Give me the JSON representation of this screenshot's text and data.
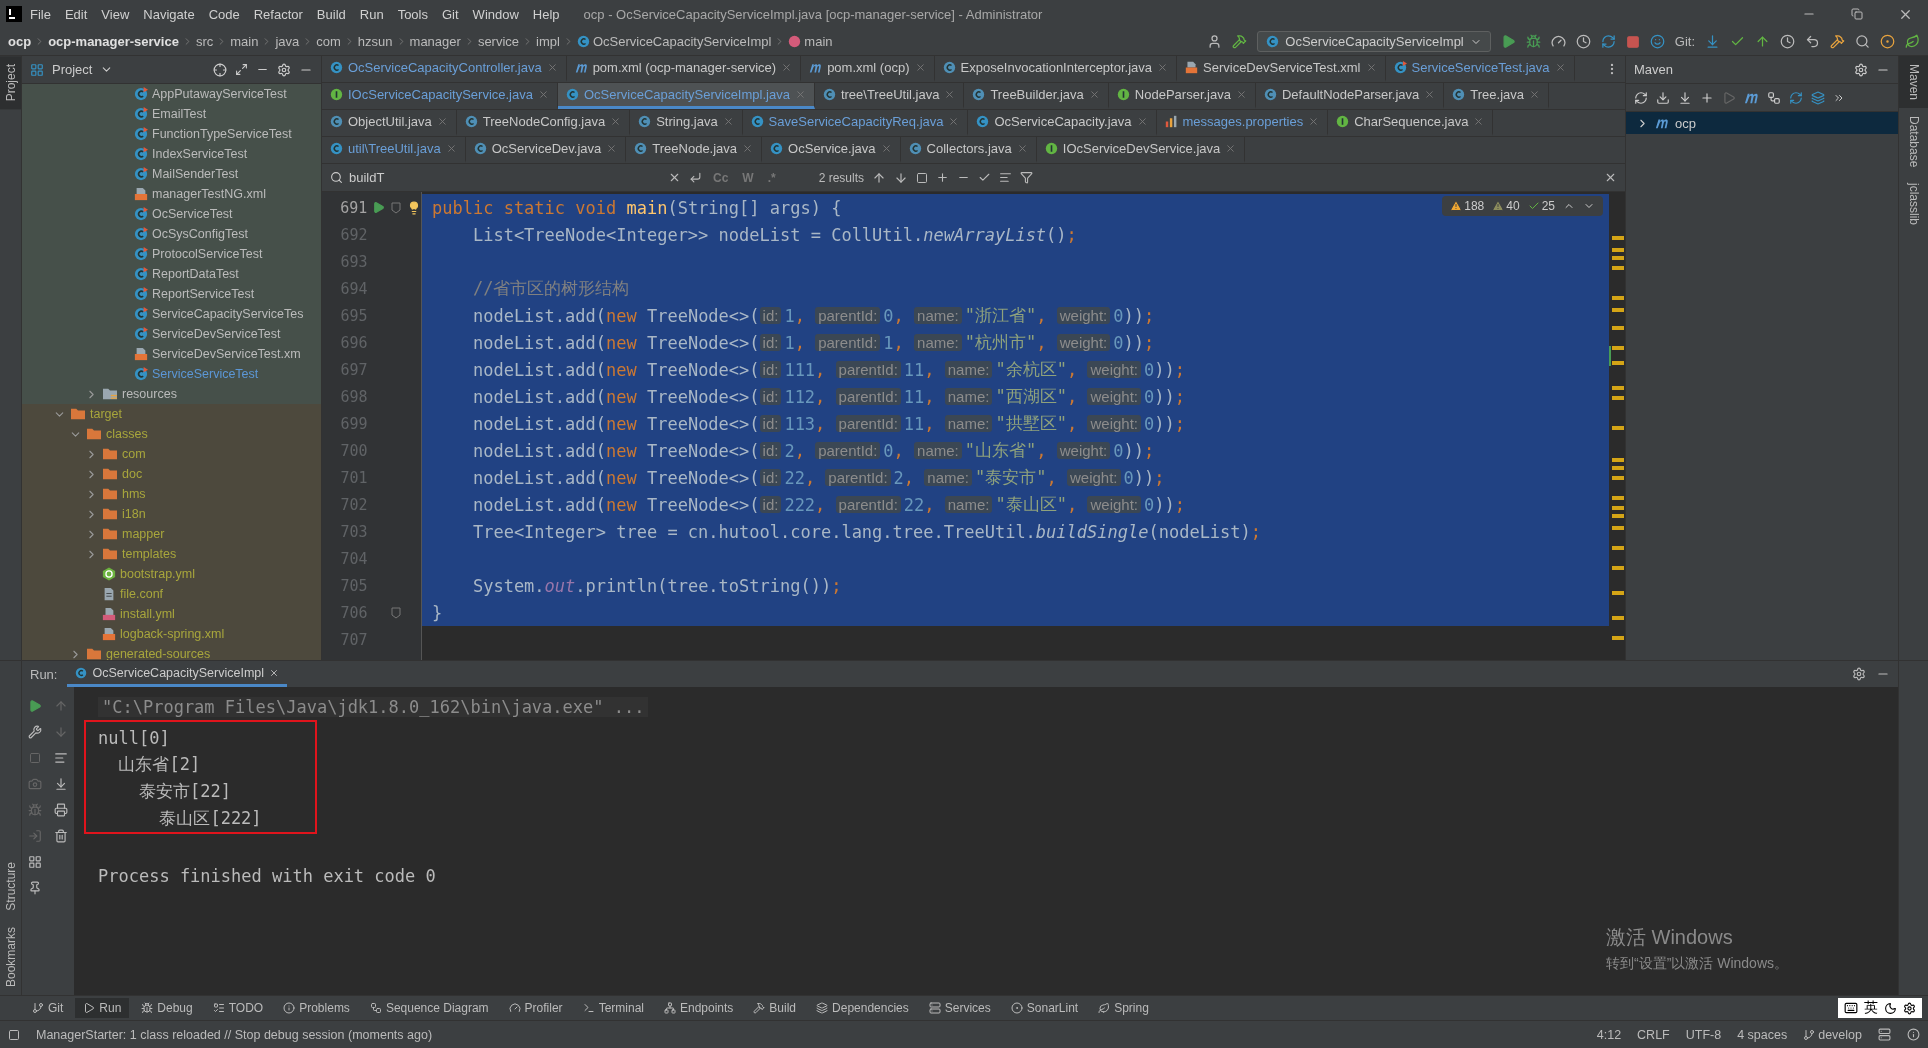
{
  "window": {
    "title": "ocp - OcServiceCapacityServiceImpl.java [ocp-manager-service] - Administrator"
  },
  "menu": [
    "File",
    "Edit",
    "View",
    "Navigate",
    "Code",
    "Refactor",
    "Build",
    "Run",
    "Tools",
    "Git",
    "Window",
    "Help"
  ],
  "breadcrumbs": [
    {
      "label": "ocp",
      "kind": "project"
    },
    {
      "label": "ocp-manager-service",
      "kind": "module"
    },
    {
      "label": "src",
      "kind": "folder"
    },
    {
      "label": "main",
      "kind": "folder"
    },
    {
      "label": "java",
      "kind": "folder"
    },
    {
      "label": "com",
      "kind": "folder"
    },
    {
      "label": "hzsun",
      "kind": "folder"
    },
    {
      "label": "manager",
      "kind": "folder"
    },
    {
      "label": "service",
      "kind": "folder"
    },
    {
      "label": "impl",
      "kind": "folder"
    },
    {
      "label": "OcServiceCapacityServiceImpl",
      "kind": "class"
    },
    {
      "label": "main",
      "kind": "method"
    }
  ],
  "run_config": "OcServiceCapacityServiceImpl",
  "git_label": "Git:",
  "left_strip": {
    "top": [
      {
        "label": "Project",
        "selected": true
      }
    ],
    "bottom": [
      {
        "label": "Structure",
        "selected": false
      },
      {
        "label": "Bookmarks",
        "selected": false
      }
    ]
  },
  "project": {
    "title": "Project",
    "tree": [
      {
        "test_sources": true,
        "children": [
          {
            "children": [
              {
                "children": [
                  {
                    "children": [
                      {
                        "label": "AppPutawayServiceTest",
                        "kind": "test-class"
                      },
                      {
                        "label": "EmailTest",
                        "kind": "test-class"
                      },
                      {
                        "label": "FunctionTypeServiceTest",
                        "kind": "test-class"
                      },
                      {
                        "label": "IndexServiceTest",
                        "kind": "test-class"
                      },
                      {
                        "label": "MailSenderTest",
                        "kind": "test-class"
                      },
                      {
                        "label": "managerTestNG.xml",
                        "kind": "xml"
                      },
                      {
                        "label": "OcServiceTest",
                        "kind": "test-class"
                      },
                      {
                        "label": "OcSysConfigTest",
                        "kind": "test-class"
                      },
                      {
                        "label": "ProtocolServiceTest",
                        "kind": "test-class"
                      },
                      {
                        "label": "ReportDataTest",
                        "kind": "test-class"
                      },
                      {
                        "label": "ReportServiceTest",
                        "kind": "test-class"
                      },
                      {
                        "label": "ServiceCapacityServiceTes",
                        "kind": "test-class"
                      },
                      {
                        "label": "ServiceDevServiceTest",
                        "kind": "test-class"
                      },
                      {
                        "label": "ServiceDevServiceTest.xm",
                        "kind": "xml"
                      },
                      {
                        "label": "ServiceServiceTest",
                        "kind": "test-class",
                        "color": "#5c97d6"
                      }
                    ]
                  }
                ]
              },
              {
                "label": "resources",
                "kind": "resources-folder",
                "expanded": false
              }
            ]
          }
        ]
      },
      {
        "label": "target",
        "kind": "folder",
        "expanded": true,
        "excluded": true,
        "children": [
          {
            "label": "classes",
            "kind": "folder",
            "expanded": true,
            "children": [
              {
                "label": "com",
                "kind": "folder",
                "expanded": false
              },
              {
                "label": "doc",
                "kind": "folder",
                "expanded": false
              },
              {
                "label": "hms",
                "kind": "folder",
                "expanded": false
              },
              {
                "label": "i18n",
                "kind": "folder",
                "expanded": false
              },
              {
                "label": "mapper",
                "kind": "folder",
                "expanded": false
              },
              {
                "label": "templates",
                "kind": "folder",
                "expanded": false
              },
              {
                "label": "bootstrap.yml",
                "kind": "spring"
              },
              {
                "label": "file.conf",
                "kind": "file"
              },
              {
                "label": "install.yml",
                "kind": "yml"
              },
              {
                "label": "logback-spring.xml",
                "kind": "xml"
              }
            ]
          },
          {
            "label": "generated-sources",
            "kind": "folder",
            "expanded": false
          }
        ]
      }
    ]
  },
  "editor": {
    "tab_rows": [
      {
        "tabs": [
          {
            "label": "OcServiceCapacityController.java",
            "kind": "class",
            "color": "#6a9fd8",
            "selected": false
          },
          {
            "label": "pom.xml (ocp-manager-service)",
            "kind": "maven",
            "color": "#c8c8c8",
            "selected": false
          },
          {
            "label": "pom.xml (ocp)",
            "kind": "maven",
            "color": "#c8c8c8",
            "selected": false
          },
          {
            "label": "ExposeInvocationInterceptor.java",
            "kind": "lib-class",
            "color": "#c8c8c8",
            "selected": false
          },
          {
            "label": "ServiceDevServiceTest.xml",
            "kind": "xml",
            "color": "#c8c8c8",
            "selected": false
          },
          {
            "label": "ServiceServiceTest.java",
            "kind": "test-class",
            "color": "#6a9fd8",
            "selected": false
          }
        ]
      },
      {
        "tabs": [
          {
            "label": "IOcServiceCapacityService.java",
            "kind": "interface",
            "color": "#6a9fd8",
            "selected": false
          },
          {
            "label": "OcServiceCapacityServiceImpl.java",
            "kind": "class",
            "color": "#6a9fd8",
            "selected": true
          },
          {
            "label": "tree\\TreeUtil.java",
            "kind": "lib-class",
            "color": "#c8c8c8",
            "selected": false
          },
          {
            "label": "TreeBuilder.java",
            "kind": "lib-class",
            "color": "#c8c8c8",
            "selected": false
          },
          {
            "label": "NodeParser.java",
            "kind": "interface",
            "color": "#c8c8c8",
            "selected": false
          },
          {
            "label": "DefaultNodeParser.java",
            "kind": "lib-class",
            "color": "#c8c8c8",
            "selected": false
          },
          {
            "label": "Tree.java",
            "kind": "lib-class",
            "color": "#c8c8c8",
            "selected": false
          }
        ]
      },
      {
        "tabs": [
          {
            "label": "ObjectUtil.java",
            "kind": "lib-class",
            "color": "#c8c8c8",
            "selected": false
          },
          {
            "label": "TreeNodeConfig.java",
            "kind": "lib-class",
            "color": "#c8c8c8",
            "selected": false
          },
          {
            "label": "String.java",
            "kind": "lib-class",
            "color": "#c8c8c8",
            "selected": false
          },
          {
            "label": "SaveServiceCapacityReq.java",
            "kind": "class",
            "color": "#6a9fd8",
            "selected": false
          },
          {
            "label": "OcServiceCapacity.java",
            "kind": "class",
            "color": "#c8c8c8",
            "selected": false
          },
          {
            "label": "messages.properties",
            "kind": "properties",
            "color": "#6a9fd8",
            "selected": false
          },
          {
            "label": "CharSequence.java",
            "kind": "interface",
            "color": "#c8c8c8",
            "selected": false
          }
        ]
      },
      {
        "tabs": [
          {
            "label": "util\\TreeUtil.java",
            "kind": "class",
            "color": "#6a9fd8",
            "selected": false
          },
          {
            "label": "OcServiceDev.java",
            "kind": "lib-class",
            "color": "#c8c8c8",
            "selected": false
          },
          {
            "label": "TreeNode.java",
            "kind": "lib-class",
            "color": "#c8c8c8",
            "selected": false
          },
          {
            "label": "OcService.java",
            "kind": "class",
            "color": "#c8c8c8",
            "selected": false
          },
          {
            "label": "Collectors.java",
            "kind": "lib-class",
            "color": "#c8c8c8",
            "selected": false
          },
          {
            "label": "IOcServiceDevService.java",
            "kind": "interface",
            "color": "#c8c8c8",
            "selected": false
          }
        ]
      }
    ],
    "find": {
      "value": "buildT",
      "results": "2 results",
      "options": [
        "Cc",
        "W",
        ".*"
      ]
    },
    "inspections": [
      {
        "kind": "warning",
        "count": "188"
      },
      {
        "kind": "weak",
        "count": "40"
      },
      {
        "kind": "typo",
        "count": "25"
      }
    ],
    "lines": [
      {
        "number": "691",
        "selected": true,
        "runnable": true,
        "bulb": true,
        "fold": true,
        "tokens": [
          {
            "t": "public static void ",
            "kind": "kw"
          },
          {
            "t": "main",
            "kind": "method"
          },
          {
            "t": "(String[] args) {",
            "kind": "plain"
          }
        ]
      },
      {
        "number": "692",
        "selected": true,
        "tokens": [
          {
            "t": "    List<TreeNode<Integer>> nodeList = CollUtil.",
            "kind": "plain"
          },
          {
            "t": "newArrayList",
            "kind": "italic"
          },
          {
            "t": "()",
            "kind": "plain"
          },
          {
            "t": ";",
            "kind": "kw"
          }
        ]
      },
      {
        "number": "693",
        "selected": true
      },
      {
        "number": "694",
        "selected": true,
        "tokens": [
          {
            "t": "    //省市区的树形结构",
            "kind": "comment"
          }
        ]
      },
      {
        "number": "695",
        "selected": true,
        "tokens": [
          {
            "t": "    nodeList.add(",
            "kind": "plain"
          },
          {
            "t": "new",
            "kind": "kw"
          },
          {
            "t": " TreeNode<>(",
            "kind": "plain"
          },
          {
            "t": "id:",
            "kind": "hint"
          },
          {
            "t": "1",
            "kind": "num"
          },
          {
            "t": ", ",
            "kind": "kw"
          },
          {
            "t": "parentId:",
            "kind": "hint"
          },
          {
            "t": "0",
            "kind": "num"
          },
          {
            "t": ", ",
            "kind": "kw"
          },
          {
            "t": "name:",
            "kind": "hint"
          },
          {
            "t": "\"浙江省\"",
            "kind": "str"
          },
          {
            "t": ", ",
            "kind": "kw"
          },
          {
            "t": "weight:",
            "kind": "hint"
          },
          {
            "t": "0",
            "kind": "num"
          },
          {
            "t": "))",
            "kind": "plain"
          },
          {
            "t": ";",
            "kind": "kw"
          }
        ]
      },
      {
        "number": "696",
        "selected": true,
        "tokens": [
          {
            "t": "    nodeList.add(",
            "kind": "plain"
          },
          {
            "t": "new",
            "kind": "kw"
          },
          {
            "t": " TreeNode<>(",
            "kind": "plain"
          },
          {
            "t": "id:",
            "kind": "hint"
          },
          {
            "t": "1",
            "kind": "num"
          },
          {
            "t": ", ",
            "kind": "kw"
          },
          {
            "t": "parentId:",
            "kind": "hint"
          },
          {
            "t": "1",
            "kind": "num"
          },
          {
            "t": ", ",
            "kind": "kw"
          },
          {
            "t": "name:",
            "kind": "hint"
          },
          {
            "t": "\"杭州市\"",
            "kind": "str"
          },
          {
            "t": ", ",
            "kind": "kw"
          },
          {
            "t": "weight:",
            "kind": "hint"
          },
          {
            "t": "0",
            "kind": "num"
          },
          {
            "t": "))",
            "kind": "plain"
          },
          {
            "t": ";",
            "kind": "kw"
          }
        ]
      },
      {
        "number": "697",
        "selected": true,
        "tokens": [
          {
            "t": "    nodeList.add(",
            "kind": "plain"
          },
          {
            "t": "new",
            "kind": "kw"
          },
          {
            "t": " TreeNode<>(",
            "kind": "plain"
          },
          {
            "t": "id:",
            "kind": "hint"
          },
          {
            "t": "111",
            "kind": "num"
          },
          {
            "t": ", ",
            "kind": "kw"
          },
          {
            "t": "parentId:",
            "kind": "hint"
          },
          {
            "t": "11",
            "kind": "num"
          },
          {
            "t": ", ",
            "kind": "kw"
          },
          {
            "t": "name:",
            "kind": "hint"
          },
          {
            "t": "\"余杭区\"",
            "kind": "str"
          },
          {
            "t": ", ",
            "kind": "kw"
          },
          {
            "t": "weight:",
            "kind": "hint"
          },
          {
            "t": "0",
            "kind": "num"
          },
          {
            "t": "))",
            "kind": "plain"
          },
          {
            "t": ";",
            "kind": "kw"
          }
        ]
      },
      {
        "number": "698",
        "selected": true,
        "tokens": [
          {
            "t": "    nodeList.add(",
            "kind": "plain"
          },
          {
            "t": "new",
            "kind": "kw"
          },
          {
            "t": " TreeNode<>(",
            "kind": "plain"
          },
          {
            "t": "id:",
            "kind": "hint"
          },
          {
            "t": "112",
            "kind": "num"
          },
          {
            "t": ", ",
            "kind": "kw"
          },
          {
            "t": "parentId:",
            "kind": "hint"
          },
          {
            "t": "11",
            "kind": "num"
          },
          {
            "t": ", ",
            "kind": "kw"
          },
          {
            "t": "name:",
            "kind": "hint"
          },
          {
            "t": "\"西湖区\"",
            "kind": "str"
          },
          {
            "t": ", ",
            "kind": "kw"
          },
          {
            "t": "weight:",
            "kind": "hint"
          },
          {
            "t": "0",
            "kind": "num"
          },
          {
            "t": "))",
            "kind": "plain"
          },
          {
            "t": ";",
            "kind": "kw"
          }
        ]
      },
      {
        "number": "699",
        "selected": true,
        "tokens": [
          {
            "t": "    nodeList.add(",
            "kind": "plain"
          },
          {
            "t": "new",
            "kind": "kw"
          },
          {
            "t": " TreeNode<>(",
            "kind": "plain"
          },
          {
            "t": "id:",
            "kind": "hint"
          },
          {
            "t": "113",
            "kind": "num"
          },
          {
            "t": ", ",
            "kind": "kw"
          },
          {
            "t": "parentId:",
            "kind": "hint"
          },
          {
            "t": "11",
            "kind": "num"
          },
          {
            "t": ", ",
            "kind": "kw"
          },
          {
            "t": "name:",
            "kind": "hint"
          },
          {
            "t": "\"拱墅区\"",
            "kind": "str"
          },
          {
            "t": ", ",
            "kind": "kw"
          },
          {
            "t": "weight:",
            "kind": "hint"
          },
          {
            "t": "0",
            "kind": "num"
          },
          {
            "t": "))",
            "kind": "plain"
          },
          {
            "t": ";",
            "kind": "kw"
          }
        ]
      },
      {
        "number": "700",
        "selected": true,
        "tokens": [
          {
            "t": "    nodeList.add(",
            "kind": "plain"
          },
          {
            "t": "new",
            "kind": "kw"
          },
          {
            "t": " TreeNode<>(",
            "kind": "plain"
          },
          {
            "t": "id:",
            "kind": "hint"
          },
          {
            "t": "2",
            "kind": "num"
          },
          {
            "t": ", ",
            "kind": "kw"
          },
          {
            "t": "parentId:",
            "kind": "hint"
          },
          {
            "t": "0",
            "kind": "num"
          },
          {
            "t": ", ",
            "kind": "kw"
          },
          {
            "t": "name:",
            "kind": "hint"
          },
          {
            "t": "\"山东省\"",
            "kind": "str"
          },
          {
            "t": ", ",
            "kind": "kw"
          },
          {
            "t": "weight:",
            "kind": "hint"
          },
          {
            "t": "0",
            "kind": "num"
          },
          {
            "t": "))",
            "kind": "plain"
          },
          {
            "t": ";",
            "kind": "kw"
          }
        ]
      },
      {
        "number": "701",
        "selected": true,
        "tokens": [
          {
            "t": "    nodeList.add(",
            "kind": "plain"
          },
          {
            "t": "new",
            "kind": "kw"
          },
          {
            "t": " TreeNode<>(",
            "kind": "plain"
          },
          {
            "t": "id:",
            "kind": "hint"
          },
          {
            "t": "22",
            "kind": "num"
          },
          {
            "t": ", ",
            "kind": "kw"
          },
          {
            "t": "parentId:",
            "kind": "hint"
          },
          {
            "t": "2",
            "kind": "num"
          },
          {
            "t": ", ",
            "kind": "kw"
          },
          {
            "t": "name:",
            "kind": "hint"
          },
          {
            "t": "\"泰安市\"",
            "kind": "str"
          },
          {
            "t": ", ",
            "kind": "kw"
          },
          {
            "t": "weight:",
            "kind": "hint"
          },
          {
            "t": "0",
            "kind": "num"
          },
          {
            "t": "))",
            "kind": "plain"
          },
          {
            "t": ";",
            "kind": "kw"
          }
        ]
      },
      {
        "number": "702",
        "selected": true,
        "tokens": [
          {
            "t": "    nodeList.add(",
            "kind": "plain"
          },
          {
            "t": "new",
            "kind": "kw"
          },
          {
            "t": " TreeNode<>(",
            "kind": "plain"
          },
          {
            "t": "id:",
            "kind": "hint"
          },
          {
            "t": "222",
            "kind": "num"
          },
          {
            "t": ", ",
            "kind": "kw"
          },
          {
            "t": "parentId:",
            "kind": "hint"
          },
          {
            "t": "22",
            "kind": "num"
          },
          {
            "t": ", ",
            "kind": "kw"
          },
          {
            "t": "name:",
            "kind": "hint"
          },
          {
            "t": "\"泰山区\"",
            "kind": "str"
          },
          {
            "t": ", ",
            "kind": "kw"
          },
          {
            "t": "weight:",
            "kind": "hint"
          },
          {
            "t": "0",
            "kind": "num"
          },
          {
            "t": "))",
            "kind": "plain"
          },
          {
            "t": ";",
            "kind": "kw"
          }
        ]
      },
      {
        "number": "703",
        "selected": true,
        "tokens": [
          {
            "t": "    Tree<Integer> tree = cn.hutool.core.lang.tree.TreeUtil.",
            "kind": "plain"
          },
          {
            "t": "buildSingle",
            "kind": "italic"
          },
          {
            "t": "(nodeList)",
            "kind": "plain"
          },
          {
            "t": ";",
            "kind": "kw"
          }
        ]
      },
      {
        "number": "704",
        "selected": true
      },
      {
        "number": "705",
        "selected": true,
        "tokens": [
          {
            "t": "    System.",
            "kind": "plain"
          },
          {
            "t": "out",
            "kind": "static"
          },
          {
            "t": ".println(tree.toString())",
            "kind": "plain"
          },
          {
            "t": ";",
            "kind": "kw"
          }
        ]
      },
      {
        "number": "706",
        "selected": true,
        "fold": true,
        "tokens": [
          {
            "t": "}",
            "kind": "plain"
          }
        ]
      },
      {
        "number": "707",
        "selected": false
      }
    ]
  },
  "maven": {
    "title": "Maven",
    "tree": [
      {
        "label": "ocp",
        "selected": true,
        "expanded": false
      }
    ]
  },
  "right_strip": [
    {
      "label": "Maven",
      "selected": true
    },
    {
      "label": "Database",
      "selected": false
    },
    {
      "label": "jclasslib",
      "selected": false
    }
  ],
  "run": {
    "label": "Run:",
    "tab": "OcServiceCapacityServiceImpl",
    "command": "\"C:\\Program Files\\Java\\jdk1.8.0_162\\bin\\java.exe\" ...",
    "highlighted": [
      "null[0]",
      "  山东省[2]",
      "    泰安市[22]",
      "      泰山区[222]"
    ],
    "result": "Process finished with exit code 0"
  },
  "activation": {
    "title": "激活 Windows",
    "hint": "转到“设置”以激活 Windows。"
  },
  "tool_windows": [
    {
      "label": "Git",
      "kind": "git",
      "selected": false
    },
    {
      "label": "Run",
      "kind": "run",
      "selected": true
    },
    {
      "label": "Debug",
      "kind": "debug",
      "selected": false
    },
    {
      "label": "TODO",
      "kind": "list",
      "selected": false
    },
    {
      "label": "Problems",
      "kind": "info",
      "selected": false
    },
    {
      "label": "Sequence Diagram",
      "kind": "diagram",
      "selected": false
    },
    {
      "label": "Profiler",
      "kind": "profiler",
      "selected": false
    },
    {
      "label": "Terminal",
      "kind": "terminal",
      "selected": false
    },
    {
      "label": "Endpoints",
      "kind": "endpoints",
      "selected": false
    },
    {
      "label": "Build",
      "kind": "build",
      "selected": false
    },
    {
      "label": "Dependencies",
      "kind": "layers",
      "selected": false
    },
    {
      "label": "Services",
      "kind": "services",
      "selected": false
    },
    {
      "label": "SonarLint",
      "kind": "sonar",
      "selected": false
    },
    {
      "label": "Spring",
      "kind": "spring",
      "selected": false
    }
  ],
  "ime": {
    "mode": "英"
  },
  "status_bar": {
    "message": "ManagerStarter: 1 class reloaded // Stop debug session (moments ago)",
    "items": [
      "4:12",
      "CRLF",
      "UTF-8",
      "4 spaces"
    ],
    "branch": "develop"
  }
}
